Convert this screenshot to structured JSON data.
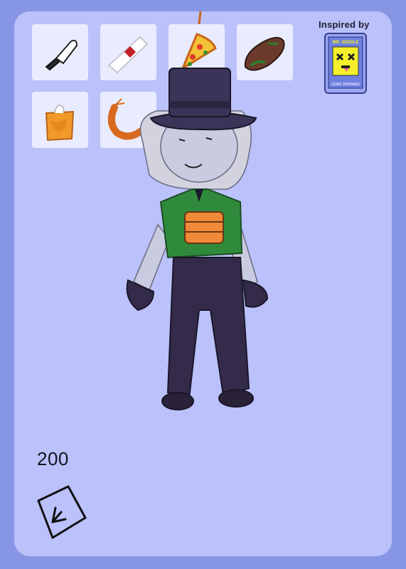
{
  "inventory": {
    "items": [
      {
        "icon": "knife-icon"
      },
      {
        "icon": "bandage-icon"
      },
      {
        "icon": "pizza-slice-icon"
      },
      {
        "icon": "sausage-icon"
      },
      {
        "icon": "tissue-box-icon"
      },
      {
        "icon": "shrimp-icon"
      }
    ]
  },
  "inspired": {
    "label": "Inspired by",
    "card_title": "MR. SEEDLE",
    "card_footer": "GORE WARNING"
  },
  "score": "200",
  "colors": {
    "background": "#8796e4",
    "card": "#bac1fb",
    "slot": "#e9ecfe",
    "hat": "#3a3458",
    "shirt": "#2f8a3c",
    "pants": "#342b4a",
    "skin": "#c9cbe0",
    "belt": "#f08a3a"
  }
}
